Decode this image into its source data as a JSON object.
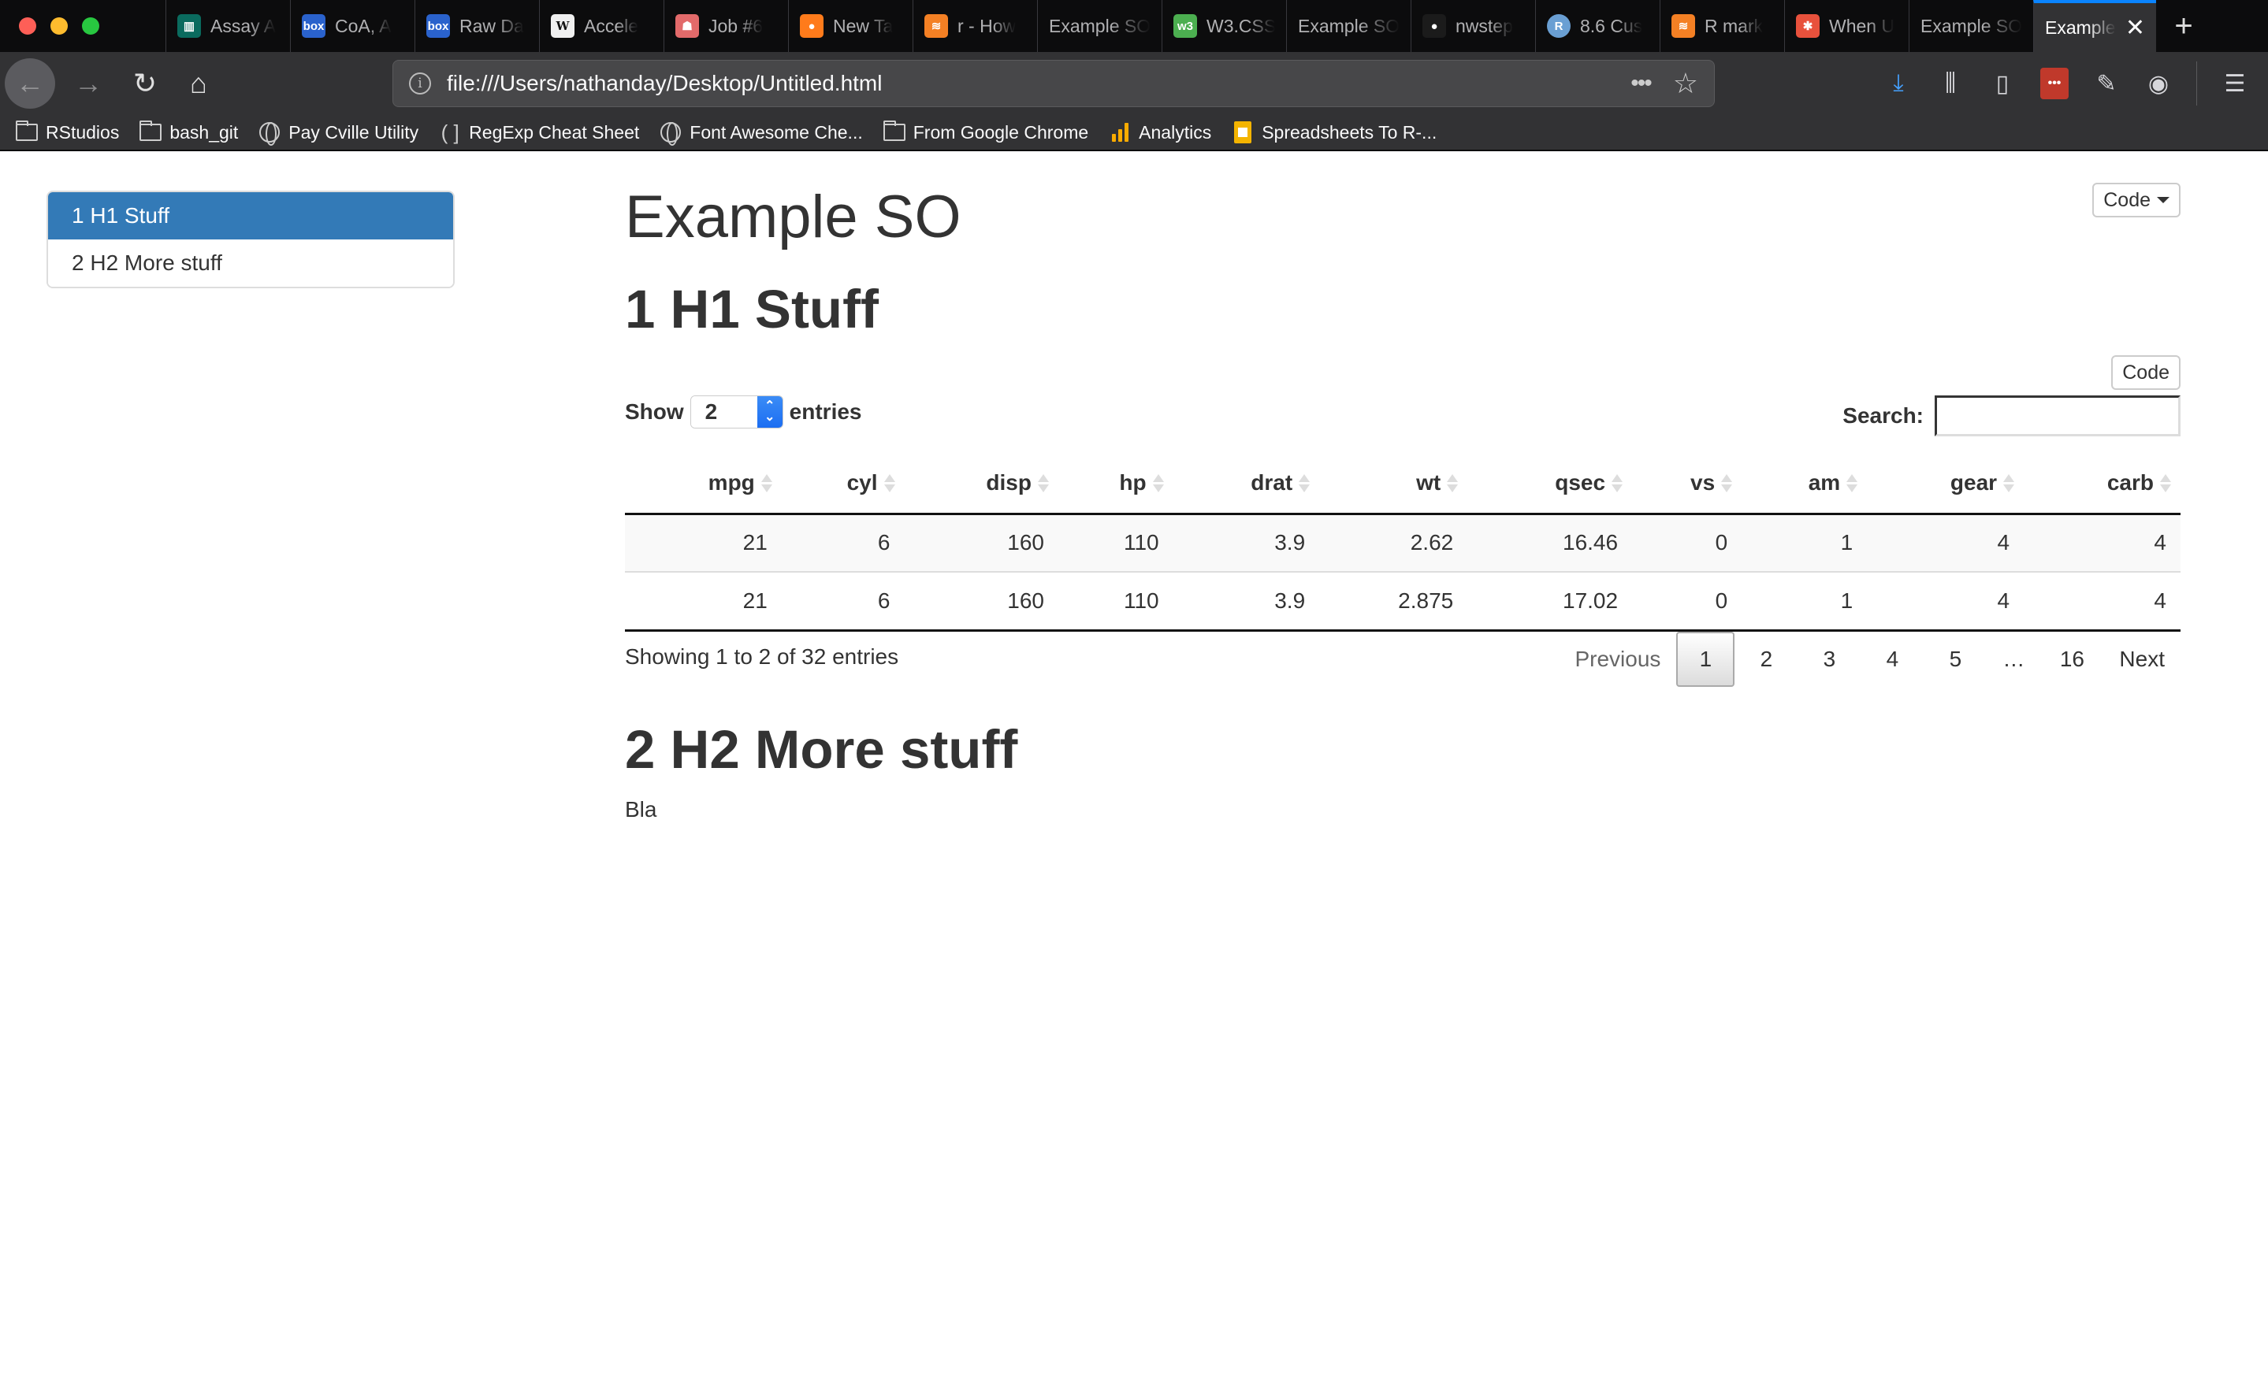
{
  "browser": {
    "tabs": [
      {
        "label": "Assay A",
        "icon": "trello-icon",
        "icon_color": "#0a6b5e"
      },
      {
        "label": "CoA, A",
        "icon": "box-icon",
        "icon_color": "#2a62cc"
      },
      {
        "label": "Raw Da",
        "icon": "box-icon",
        "icon_color": "#2a62cc"
      },
      {
        "label": "Accele",
        "icon": "wikipedia-icon",
        "icon_color": "#f0f0f0"
      },
      {
        "label": "Job #6",
        "icon": "job-icon",
        "icon_color": "#e26a6a"
      },
      {
        "label": "New Ta",
        "icon": "firefox-icon",
        "icon_color": "#ff7b1b"
      },
      {
        "label": "r - How",
        "icon": "stackoverflow-icon",
        "icon_color": "#f48024"
      },
      {
        "label": "Example SO",
        "icon": "",
        "icon_color": ""
      },
      {
        "label": "W3.CSS",
        "icon": "w3schools-icon",
        "icon_color": "#4caf50"
      },
      {
        "label": "Example SO",
        "icon": "",
        "icon_color": ""
      },
      {
        "label": "nwstep",
        "icon": "github-icon",
        "icon_color": "#1b1b1b"
      },
      {
        "label": "8.6 Cus",
        "icon": "r-icon",
        "icon_color": "#6a9fd3"
      },
      {
        "label": "R mark",
        "icon": "stackoverflow-icon",
        "icon_color": "#f48024"
      },
      {
        "label": "When U",
        "icon": "asterisk-icon",
        "icon_color": "#e8513c"
      },
      {
        "label": "Example SO",
        "icon": "",
        "icon_color": ""
      },
      {
        "label": "Example SO",
        "icon": "",
        "icon_color": "",
        "active": true
      }
    ],
    "new_tab": "+",
    "close_tab": "✕",
    "url": "file:///Users/nathanday/Desktop/Untitled.html",
    "bookmarks": [
      {
        "label": "RStudios",
        "icon": "folder-icon"
      },
      {
        "label": "bash_git",
        "icon": "folder-icon"
      },
      {
        "label": "Pay Cville Utility",
        "icon": "globe-icon"
      },
      {
        "label": "RegExp Cheat Sheet",
        "icon": "bracket-icon"
      },
      {
        "label": "Font Awesome Che...",
        "icon": "globe-icon"
      },
      {
        "label": "From Google Chrome",
        "icon": "folder-icon"
      },
      {
        "label": "Analytics",
        "icon": "analytics-icon"
      },
      {
        "label": "Spreadsheets To R-...",
        "icon": "sheets-icon"
      }
    ]
  },
  "page": {
    "toc": [
      {
        "label": "1 H1 Stuff",
        "active": true
      },
      {
        "label": "2 H2 More stuff",
        "active": false
      }
    ],
    "title": "Example SO",
    "code_menu_label": "Code",
    "section1": {
      "heading": "1 H1 Stuff",
      "code_button": "Code"
    },
    "datatable": {
      "show_label": "Show",
      "length_value": "2",
      "entries_label": "entries",
      "search_label": "Search:",
      "search_value": "",
      "columns": [
        "mpg",
        "cyl",
        "disp",
        "hp",
        "drat",
        "wt",
        "qsec",
        "vs",
        "am",
        "gear",
        "carb"
      ],
      "rows": [
        [
          "21",
          "6",
          "160",
          "110",
          "3.9",
          "2.62",
          "16.46",
          "0",
          "1",
          "4",
          "4"
        ],
        [
          "21",
          "6",
          "160",
          "110",
          "3.9",
          "2.875",
          "17.02",
          "0",
          "1",
          "4",
          "4"
        ]
      ],
      "info": "Showing 1 to 2 of 32 entries",
      "pagination": {
        "previous": "Previous",
        "pages": [
          "1",
          "2",
          "3",
          "4",
          "5"
        ],
        "ellipsis": "…",
        "last": "16",
        "next": "Next",
        "current": "1"
      }
    },
    "section2": {
      "heading": "2 H2 More stuff",
      "body": "Bla"
    }
  },
  "colors": {
    "toc_active": "#337ab7",
    "tab_accent": "#0a84ff",
    "text": "#333333"
  }
}
